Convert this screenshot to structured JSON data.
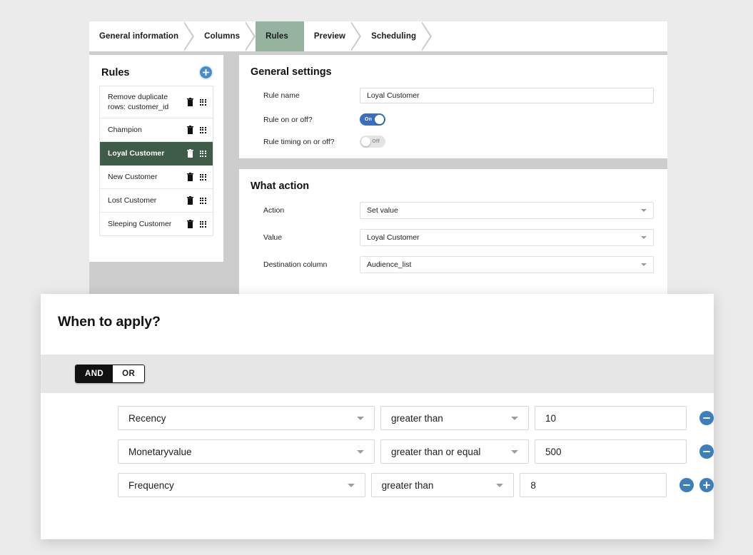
{
  "wizard": {
    "tabs": [
      {
        "label": "General information",
        "active": false
      },
      {
        "label": "Columns",
        "active": false
      },
      {
        "label": "Rules",
        "active": true
      },
      {
        "label": "Preview",
        "active": false
      },
      {
        "label": "Scheduling",
        "active": false
      }
    ],
    "accent_green": "#96b39f",
    "selected_rule_green": "#3f5c49",
    "accent_blue": "#3d7ebc"
  },
  "rules_panel": {
    "title": "Rules",
    "add_icon": "plus-circle-icon",
    "items": [
      {
        "label": "Remove duplicate rows: customer_id",
        "selected": false
      },
      {
        "label": "Champion",
        "selected": false
      },
      {
        "label": "Loyal Customer",
        "selected": true
      },
      {
        "label": "New Customer",
        "selected": false
      },
      {
        "label": "Lost Customer",
        "selected": false
      },
      {
        "label": "Sleeping Customer",
        "selected": false
      }
    ]
  },
  "general_settings": {
    "title": "General settings",
    "rule_name": {
      "label": "Rule name",
      "value": "Loyal Customer"
    },
    "rule_on_off": {
      "label": "Rule on or off?",
      "state": "on",
      "state_label": "On"
    },
    "rule_timing_on_off": {
      "label": "Rule timing on or off?",
      "state": "off",
      "state_label": "Off"
    }
  },
  "what_action": {
    "title": "What action",
    "fields": [
      {
        "label": "Action",
        "value": "Set value"
      },
      {
        "label": "Value",
        "value": "Loyal Customer"
      },
      {
        "label": "Destination column",
        "value": "Audience_list"
      }
    ]
  },
  "when_to_apply": {
    "title": "When to apply?",
    "logic": {
      "options": [
        "AND",
        "OR"
      ],
      "selected": "AND"
    },
    "conditions": [
      {
        "field": "Recency",
        "operator": "greater than",
        "value": "10",
        "has_add": false
      },
      {
        "field": "Monetaryvalue",
        "operator": "greater than or equal",
        "value": "500",
        "has_add": false
      },
      {
        "field": "Frequency",
        "operator": "greater than",
        "value": "8",
        "has_add": true
      }
    ],
    "remove_icon": "minus-circle-icon",
    "add_icon": "plus-circle-icon"
  }
}
